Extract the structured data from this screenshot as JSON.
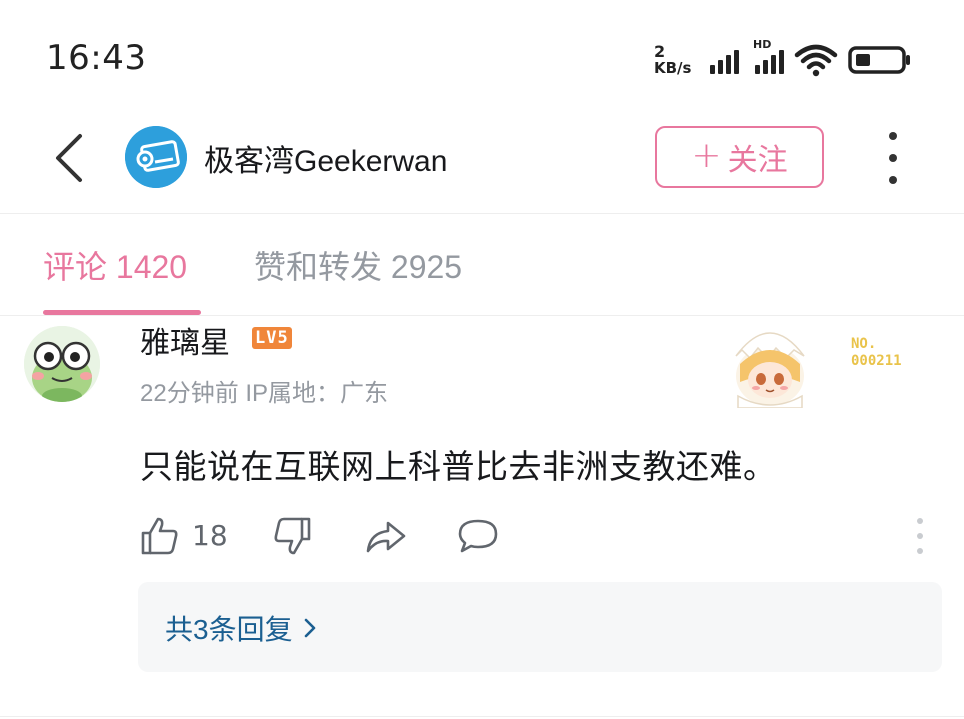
{
  "status_bar": {
    "time": "16:43",
    "net_speed_value": "2",
    "net_speed_unit": "KB/s",
    "hd_label": "HD",
    "icons": [
      "signal-icon",
      "signal-hd-icon",
      "wifi-icon",
      "battery-icon"
    ]
  },
  "header": {
    "back_icon": "chevron-left-icon",
    "up_name": "极客湾Geekerwan",
    "follow_plus": "+",
    "follow_label": "关注",
    "more_icon": "more-vertical-icon"
  },
  "tabs": [
    {
      "label": "评论 1420",
      "active": true
    },
    {
      "label": "赞和转发 2925",
      "active": false
    }
  ],
  "comment": {
    "username": "雅璃星",
    "level": "LV5",
    "meta": "22分钟前 IP属地：广东",
    "decoration_no": "NO.",
    "decoration_serial": "000211",
    "text": "只能说在互联网上科普比去非洲支教还难。",
    "like_count": "18",
    "reply_summary": "共3条回复"
  },
  "colors": {
    "accent_pink": "#e8779e",
    "text_gray": "#9499a0",
    "link_blue": "#1b5f91",
    "level_orange": "#f0863a",
    "reply_bg": "#f6f7f8"
  }
}
